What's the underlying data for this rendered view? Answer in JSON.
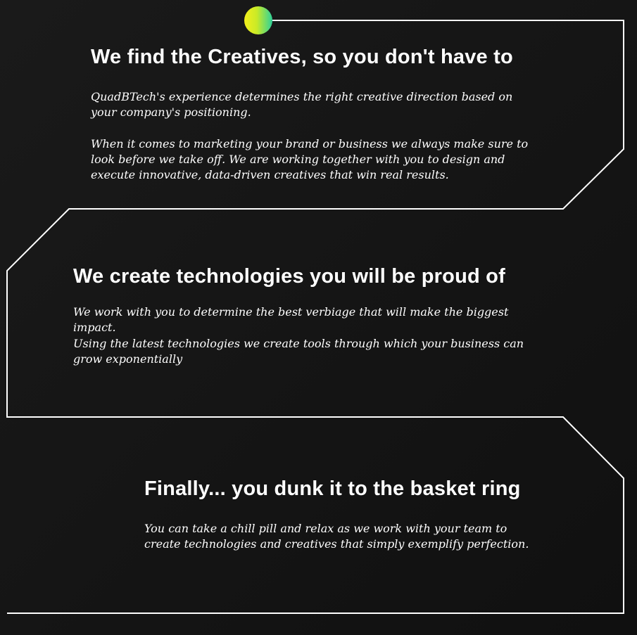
{
  "sections": [
    {
      "heading": "We find the Creatives, so you don't have to",
      "paragraphs": [
        "QuadBTech's experience determines the right creative direction based on your company's positioning.",
        "When it comes to marketing your brand or business we always make sure to look before we take off. We are working together with you to design and execute innovative, data-driven creatives that win real results."
      ]
    },
    {
      "heading": "We create technologies you will be proud of",
      "paragraphs": [
        "We work with you to determine the best verbiage that will make the biggest impact.",
        "Using the latest technologies we create tools through which your business can grow exponentially"
      ]
    },
    {
      "heading": "Finally... you dunk it to the basket ring",
      "paragraphs": [
        "You can take a chill pill and relax as we work with your team to create technologies and creatives that simply exemplify perfection."
      ]
    }
  ],
  "colors": {
    "background": "#151515",
    "line": "#ffffff",
    "dot_start": "#f4ef1b",
    "dot_end": "#2ed19a"
  }
}
